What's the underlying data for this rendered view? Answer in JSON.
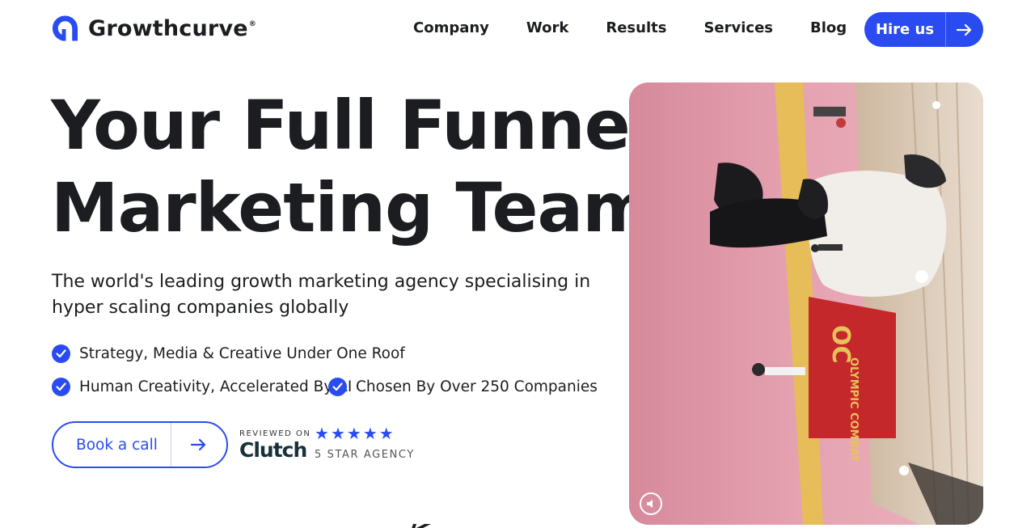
{
  "brand": {
    "name": "Growthcurve",
    "registered_mark": "®",
    "accent_color": "#2b4bf2"
  },
  "nav": {
    "links": [
      "Company",
      "Work",
      "Results",
      "Services",
      "Blog"
    ],
    "cta_label": "Hire us"
  },
  "hero": {
    "headline_line1": "Your Full Funnel",
    "headline_line2": "Marketing Team",
    "subtitle": "The world's leading growth marketing agency specialising in hyper scaling companies globally",
    "features": [
      "Strategy, Media & Creative Under One Roof",
      "Human Creativity, Accelerated By AI",
      "Chosen By Over 250 Companies"
    ],
    "cta_label": "Book a call"
  },
  "review": {
    "reviewed_on": "REVIEWED ON",
    "platform": "Clutch",
    "rating_stars": 5,
    "badge_text": "5 STAR AGENCY"
  },
  "video": {
    "banner_text": "OLYMPIC COMBAT",
    "banner_initials": "OC"
  },
  "icons": {
    "logo": "growthcurve-logo-icon",
    "arrow": "arrow-right-icon",
    "check": "check-circle-icon",
    "star": "star-icon",
    "mute": "speaker-muted-icon"
  }
}
